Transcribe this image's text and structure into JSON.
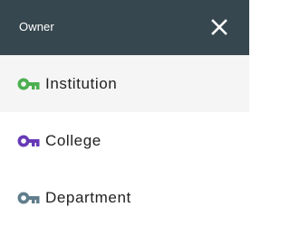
{
  "header": {
    "title": "Owner",
    "close_icon": "close-icon"
  },
  "colors": {
    "header_bg": "#37474f",
    "selected_bg": "#f5f5f5"
  },
  "items": [
    {
      "label": "Institution",
      "icon": "key-icon",
      "icon_color": "#4caf50",
      "selected": true
    },
    {
      "label": "College",
      "icon": "key-icon",
      "icon_color": "#673ab7",
      "selected": false
    },
    {
      "label": "Department",
      "icon": "key-icon",
      "icon_color": "#607d8b",
      "selected": false
    }
  ]
}
